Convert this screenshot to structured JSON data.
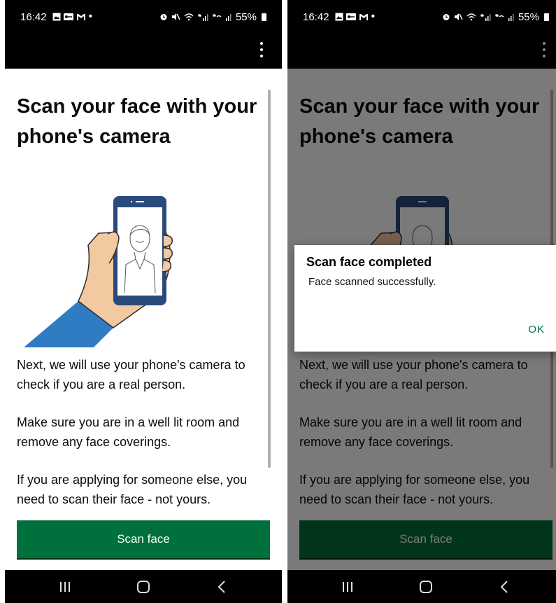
{
  "colors": {
    "primary_button": "#00703c",
    "text": "#0b0c0c",
    "bar": "#000000",
    "dialog_action": "#00703c",
    "sleeve": "#2f7cc3",
    "phone": "#2a4a7c"
  },
  "status_bar": {
    "time": "16:42",
    "left_icons": [
      "gallery-icon",
      "vpn-key-icon",
      "gmail-icon",
      "dot-icon"
    ],
    "right_icons": [
      "alarm-icon",
      "mute-icon",
      "wifi-call-icon",
      "signal-icon",
      "wifi-call-icon",
      "signal-icon"
    ],
    "battery": "55%"
  },
  "app_bar": {
    "menu_icon": "more-vert-icon"
  },
  "screen": {
    "title": "Scan your face with your phone's camera",
    "illustration": "hand-holding-phone-face-illustration",
    "paragraphs": [
      "Next, we will use your phone's camera to check if you are a real person.",
      "Make sure you are in a well lit room and remove any face coverings.",
      "If you are applying for someone else, you need to scan their face - not yours."
    ],
    "button_label": "Scan face"
  },
  "dialog": {
    "title": "Scan face completed",
    "message": "Face scanned successfully.",
    "action": "OK"
  },
  "nav_bar": {
    "buttons": [
      "recents-icon",
      "home-icon",
      "back-icon"
    ]
  }
}
